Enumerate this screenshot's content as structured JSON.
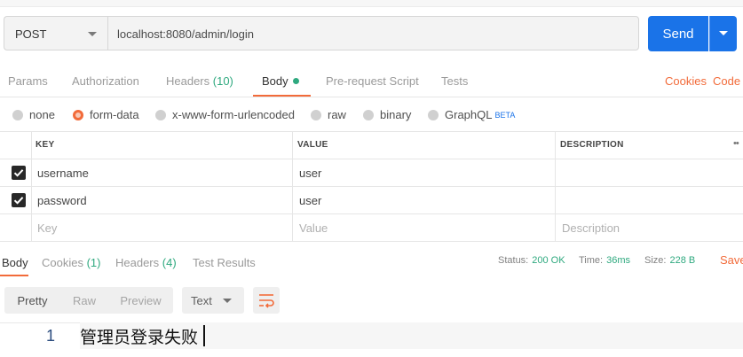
{
  "request": {
    "method": "POST",
    "url": "localhost:8080/admin/login",
    "send_label": "Send"
  },
  "request_tabs": {
    "params": "Params",
    "authorization": "Authorization",
    "headers": "Headers",
    "headers_count": "(10)",
    "body": "Body",
    "prerequest": "Pre-request Script",
    "tests": "Tests",
    "cookies": "Cookies",
    "code": "Code"
  },
  "body_types": {
    "none": "none",
    "form_data": "form-data",
    "urlencoded": "x-www-form-urlencoded",
    "raw": "raw",
    "binary": "binary",
    "graphql": "GraphQL",
    "beta": "BETA",
    "selected": "form-data"
  },
  "params_table": {
    "headers": [
      "KEY",
      "VALUE",
      "DESCRIPTION"
    ],
    "rows": [
      {
        "checked": true,
        "key": "username",
        "value": "user",
        "description": ""
      },
      {
        "checked": true,
        "key": "password",
        "value": "user",
        "description": ""
      }
    ],
    "placeholders": {
      "key": "Key",
      "value": "Value",
      "description": "Description"
    }
  },
  "response_tabs": {
    "body": "Body",
    "cookies": "Cookies",
    "cookies_count": "(1)",
    "headers": "Headers",
    "headers_count": "(4)",
    "test_results": "Test Results"
  },
  "response_meta": {
    "status_label": "Status:",
    "status_value": "200 OK",
    "time_label": "Time:",
    "time_value": "36ms",
    "size_label": "Size:",
    "size_value": "228 B",
    "save_label": "Save"
  },
  "response_view": {
    "pretty": "Pretty",
    "raw": "Raw",
    "preview": "Preview",
    "format": "Text"
  },
  "response_body": {
    "line_number": "1",
    "text": "管理员登录失败"
  },
  "colors": {
    "accent": "#f26b3a",
    "send": "#1a73e8",
    "success": "#2fa97f"
  },
  "icons": [
    "chevron-down-icon",
    "checkbox-checked-icon",
    "wrap-lines-icon",
    "more-icon"
  ]
}
